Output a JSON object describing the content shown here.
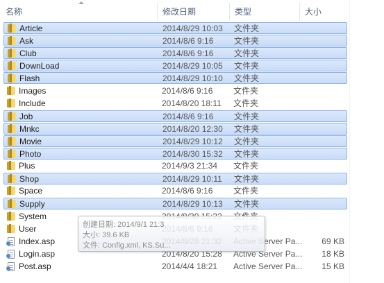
{
  "columns": {
    "name": "名称",
    "date": "修改日期",
    "type": "类型",
    "size": "大小"
  },
  "rows": [
    {
      "name": "Article",
      "date": "2014/8/29 10:03",
      "type": "文件夹",
      "size": "",
      "icon": "folder-icon",
      "selected": true
    },
    {
      "name": "Ask",
      "date": "2014/8/6 9:16",
      "type": "文件夹",
      "size": "",
      "icon": "folder-icon",
      "selected": true
    },
    {
      "name": "Club",
      "date": "2014/8/6 9:16",
      "type": "文件夹",
      "size": "",
      "icon": "folder-icon",
      "selected": true
    },
    {
      "name": "DownLoad",
      "date": "2014/8/29 10:05",
      "type": "文件夹",
      "size": "",
      "icon": "folder-icon",
      "selected": true
    },
    {
      "name": "Flash",
      "date": "2014/8/29 10:10",
      "type": "文件夹",
      "size": "",
      "icon": "folder-icon",
      "selected": true
    },
    {
      "name": "Images",
      "date": "2014/8/6 9:16",
      "type": "文件夹",
      "size": "",
      "icon": "folder-icon",
      "selected": false
    },
    {
      "name": "Include",
      "date": "2014/8/20 18:11",
      "type": "文件夹",
      "size": "",
      "icon": "folder-icon",
      "selected": false
    },
    {
      "name": "Job",
      "date": "2014/8/6 9:16",
      "type": "文件夹",
      "size": "",
      "icon": "folder-icon",
      "selected": true
    },
    {
      "name": "Mnkc",
      "date": "2014/8/20 12:30",
      "type": "文件夹",
      "size": "",
      "icon": "folder-icon",
      "selected": true
    },
    {
      "name": "Movie",
      "date": "2014/8/29 10:12",
      "type": "文件夹",
      "size": "",
      "icon": "folder-icon",
      "selected": true
    },
    {
      "name": "Photo",
      "date": "2014/8/30 15:32",
      "type": "文件夹",
      "size": "",
      "icon": "folder-icon",
      "selected": true
    },
    {
      "name": "Plus",
      "date": "2014/9/3 21:34",
      "type": "文件夹",
      "size": "",
      "icon": "folder-icon",
      "selected": false
    },
    {
      "name": "Shop",
      "date": "2014/8/29 10:11",
      "type": "文件夹",
      "size": "",
      "icon": "folder-icon",
      "selected": true
    },
    {
      "name": "Space",
      "date": "2014/8/6 9:16",
      "type": "文件夹",
      "size": "",
      "icon": "folder-icon",
      "selected": false
    },
    {
      "name": "Supply",
      "date": "2014/8/29 10:13",
      "type": "文件夹",
      "size": "",
      "icon": "folder-icon",
      "selected": true
    },
    {
      "name": "System",
      "date": "2014/8/30 15:22",
      "type": "文件夹",
      "size": "",
      "icon": "folder-icon",
      "selected": false
    },
    {
      "name": "User",
      "date": "2014/8/6 9:16",
      "type": "文件夹",
      "size": "",
      "icon": "folder-icon",
      "selected": false
    },
    {
      "name": "Index.asp",
      "date": "2014/8/29 21:32",
      "type": "Active Server Pa...",
      "size": "69 KB",
      "icon": "asp-file-icon",
      "selected": false
    },
    {
      "name": "Login.asp",
      "date": "2014/8/20 15:28",
      "type": "Active Server Pa...",
      "size": "18 KB",
      "icon": "asp-file-icon",
      "selected": false
    },
    {
      "name": "Post.asp",
      "date": "2014/4/4 18:21",
      "type": "Active Server Pa...",
      "size": "15 KB",
      "icon": "asp-file-icon",
      "selected": false
    }
  ],
  "tooltip": {
    "created": "创建日期: 2014/9/1 21:3",
    "size": "大小: 39.6 KB",
    "files": "文件: Config.xml, KS.Su..."
  },
  "colors": {
    "selection_bg": "#cfe0f8",
    "selection_border": "#8eb3e6",
    "header_text": "#4c607a"
  }
}
